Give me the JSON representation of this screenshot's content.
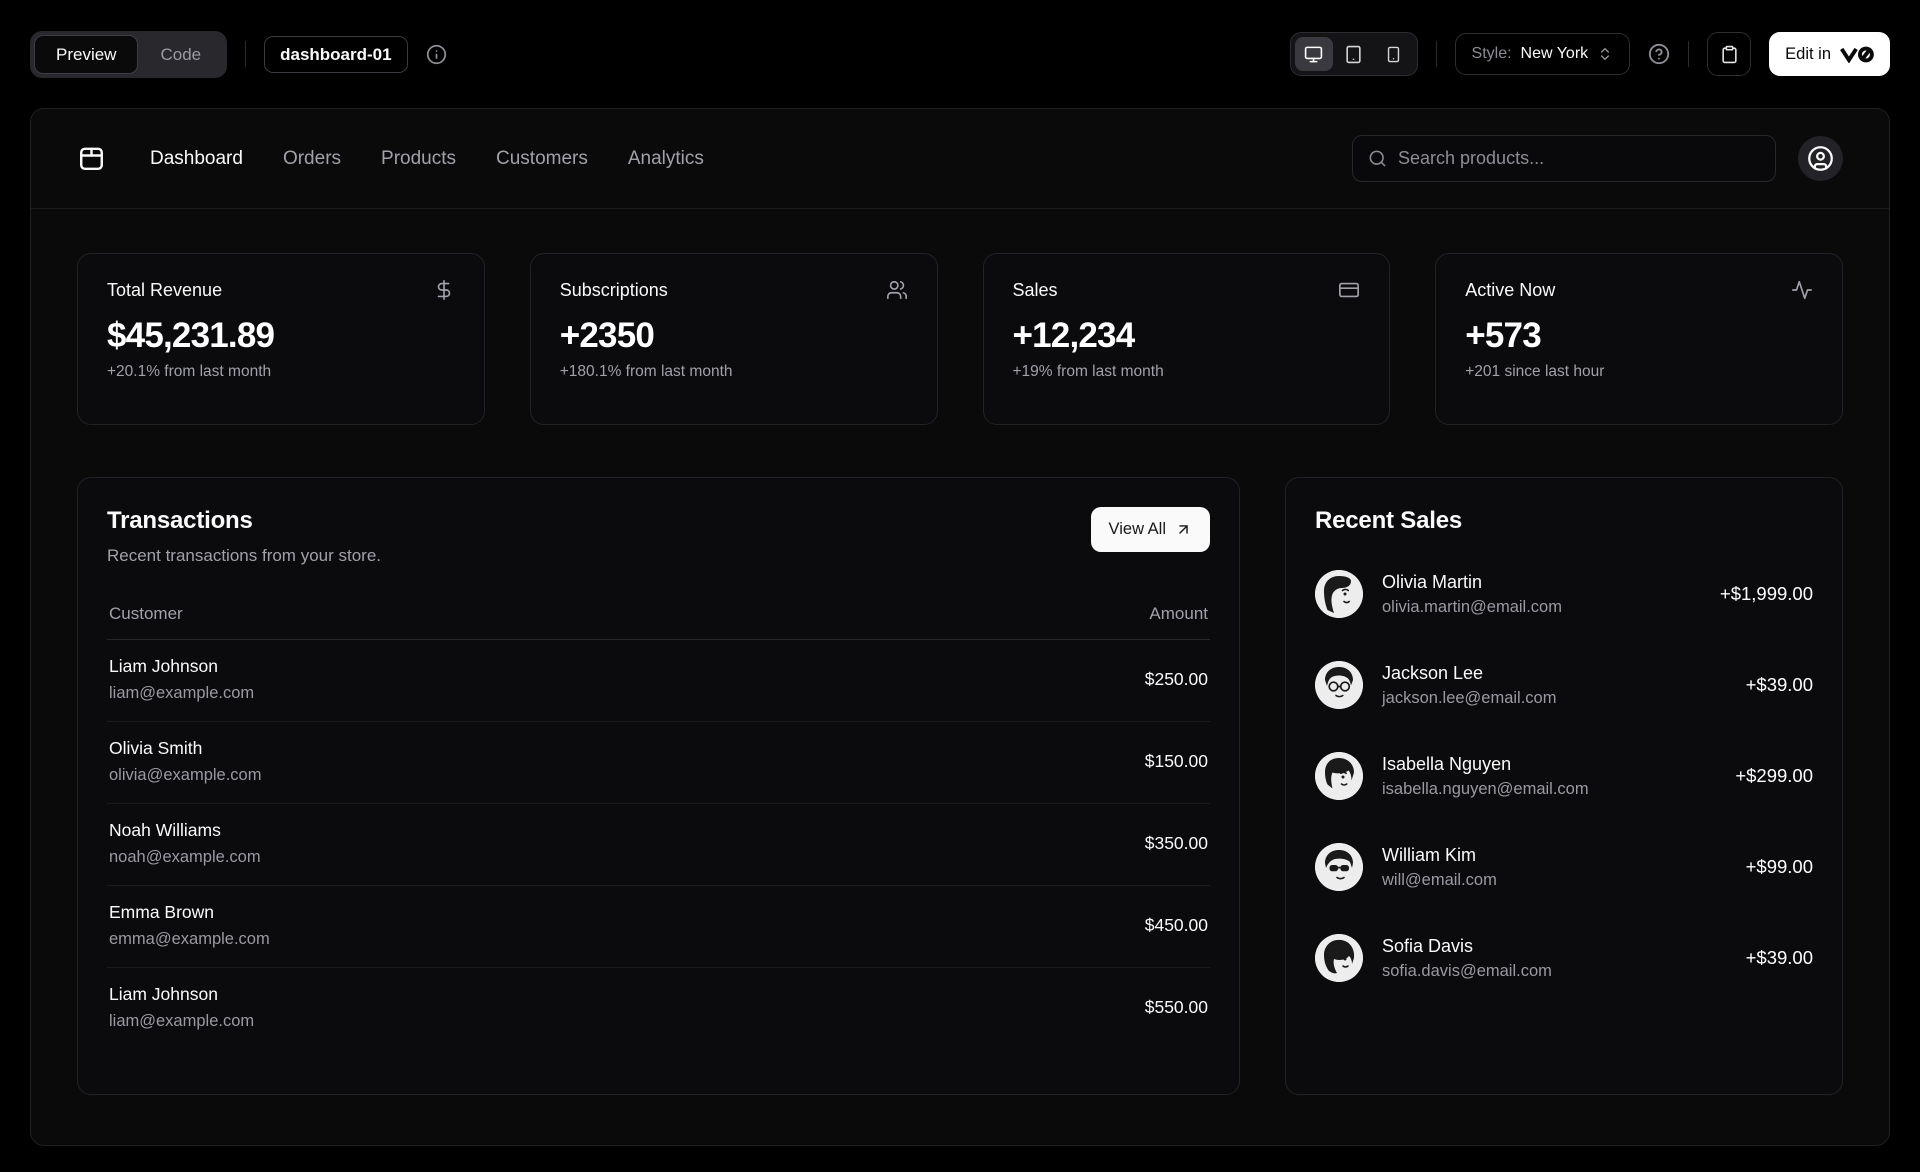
{
  "toolbar": {
    "tabs": [
      {
        "label": "Preview",
        "active": true
      },
      {
        "label": "Code",
        "active": false
      }
    ],
    "block_name": "dashboard-01",
    "style_label": "Style:",
    "style_value": "New York",
    "edit_label": "Edit in"
  },
  "nav": {
    "links": [
      {
        "label": "Dashboard",
        "active": true
      },
      {
        "label": "Orders",
        "active": false
      },
      {
        "label": "Products",
        "active": false
      },
      {
        "label": "Customers",
        "active": false
      },
      {
        "label": "Analytics",
        "active": false
      }
    ],
    "search_placeholder": "Search products..."
  },
  "stats": [
    {
      "title": "Total Revenue",
      "icon": "dollar-sign-icon",
      "value": "$45,231.89",
      "change": "+20.1% from last month"
    },
    {
      "title": "Subscriptions",
      "icon": "users-icon",
      "value": "+2350",
      "change": "+180.1% from last month"
    },
    {
      "title": "Sales",
      "icon": "credit-card-icon",
      "value": "+12,234",
      "change": "+19% from last month"
    },
    {
      "title": "Active Now",
      "icon": "activity-icon",
      "value": "+573",
      "change": "+201 since last hour"
    }
  ],
  "transactions": {
    "title": "Transactions",
    "description": "Recent transactions from your store.",
    "view_all_label": "View All",
    "columns": [
      "Customer",
      "Amount"
    ],
    "rows": [
      {
        "name": "Liam Johnson",
        "email": "liam@example.com",
        "amount": "$250.00"
      },
      {
        "name": "Olivia Smith",
        "email": "olivia@example.com",
        "amount": "$150.00"
      },
      {
        "name": "Noah Williams",
        "email": "noah@example.com",
        "amount": "$350.00"
      },
      {
        "name": "Emma Brown",
        "email": "emma@example.com",
        "amount": "$450.00"
      },
      {
        "name": "Liam Johnson",
        "email": "liam@example.com",
        "amount": "$550.00"
      }
    ]
  },
  "recent_sales": {
    "title": "Recent Sales",
    "items": [
      {
        "name": "Olivia Martin",
        "email": "olivia.martin@email.com",
        "amount": "+$1,999.00"
      },
      {
        "name": "Jackson Lee",
        "email": "jackson.lee@email.com",
        "amount": "+$39.00"
      },
      {
        "name": "Isabella Nguyen",
        "email": "isabella.nguyen@email.com",
        "amount": "+$299.00"
      },
      {
        "name": "William Kim",
        "email": "will@email.com",
        "amount": "+$99.00"
      },
      {
        "name": "Sofia Davis",
        "email": "sofia.davis@email.com",
        "amount": "+$39.00"
      }
    ]
  },
  "colors": {
    "page_background": "#000000",
    "panel_background": "#0a0a0b",
    "border": "#222227",
    "text": "#fafafa",
    "muted_text": "#a1a1aa",
    "primary_button": "#ffffff"
  }
}
